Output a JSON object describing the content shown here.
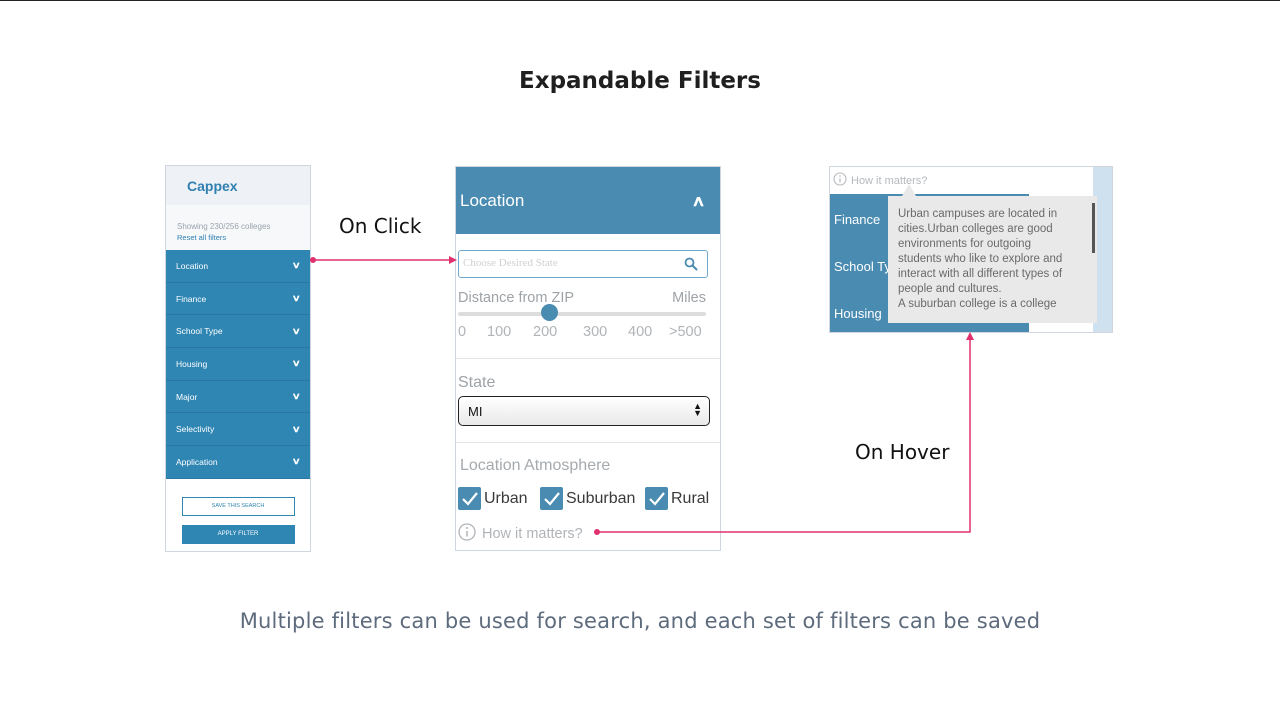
{
  "slide": {
    "title": "Expandable Filters",
    "caption": "Multiple filters can be used for search, and each set of filters can be saved",
    "on_click_label": "On Click",
    "on_hover_label": "On Hover"
  },
  "colors": {
    "primary_blue": "#2f86b3",
    "panel_blue": "#4a8bb2",
    "connector_pink": "#e0306e"
  },
  "sidebar": {
    "brand": "Cappex",
    "count_text": "Showing 230/256 colleges",
    "reset_label": "Reset all filters",
    "items": [
      {
        "label": "Location",
        "icon": "chevron-down-icon"
      },
      {
        "label": "Finance",
        "icon": "chevron-down-icon"
      },
      {
        "label": "School Type",
        "icon": "chevron-down-icon"
      },
      {
        "label": "Housing",
        "icon": "chevron-down-icon"
      },
      {
        "label": "Major",
        "icon": "chevron-down-icon"
      },
      {
        "label": "Selectivity",
        "icon": "chevron-down-icon"
      },
      {
        "label": "Application",
        "icon": "chevron-down-icon"
      }
    ],
    "save_label": "SAVE THIS SEARCH",
    "apply_label": "APPLY FILTER"
  },
  "location_panel": {
    "title": "Location",
    "search_placeholder": "Choose Desired State",
    "distance_label": "Distance from ZIP",
    "distance_unit": "Miles",
    "slider_ticks": [
      "0",
      "100",
      "200",
      "300",
      "400",
      ">500"
    ],
    "slider_value": 200,
    "slider_max": 500,
    "state_label": "State",
    "state_value": "MI",
    "atmosphere_label": "Location Atmosphere",
    "atmosphere_options": [
      {
        "label": "Urban",
        "checked": true
      },
      {
        "label": "Suburban",
        "checked": true
      },
      {
        "label": "Rural",
        "checked": true
      }
    ],
    "how_label": "How it matters?"
  },
  "hover_panel": {
    "how_label": "How it matters?",
    "items": [
      "Finance",
      "School Ty",
      "Housing"
    ],
    "tooltip_lines": [
      "Urban campuses are located in",
      "cities.Urban colleges are good",
      "environments for outgoing",
      "students who like to explore and",
      "interact with all different types of",
      "people and cultures.",
      "A suburban college is a college"
    ]
  }
}
